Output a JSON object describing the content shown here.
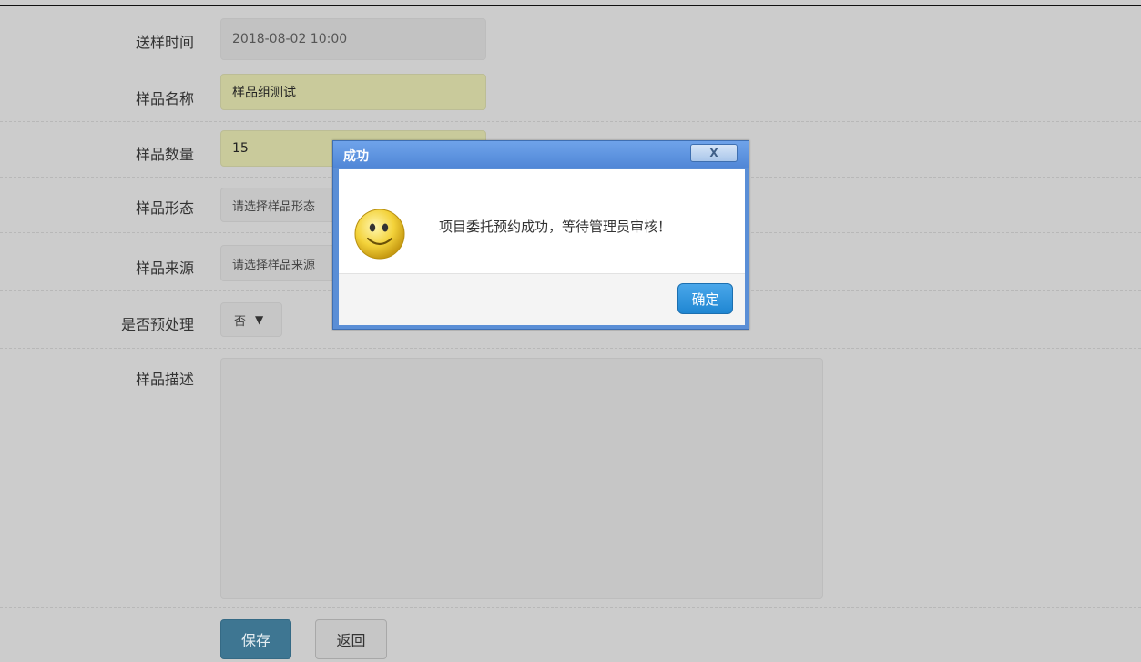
{
  "form": {
    "send_time": {
      "label": "送样时间",
      "value": "2018-08-02 10:00"
    },
    "sample_name": {
      "label": "样品名称",
      "value": "样品组测试"
    },
    "sample_count": {
      "label": "样品数量",
      "value": "15"
    },
    "sample_form": {
      "label": "样品形态",
      "value": "请选择样品形态"
    },
    "sample_source": {
      "label": "样品来源",
      "value": "请选择样品来源"
    },
    "pretreatment": {
      "label": "是否预处理",
      "value": "否",
      "caret": "▼"
    },
    "description": {
      "label": "样品描述",
      "value": ""
    },
    "buttons": {
      "save": "保存",
      "back": "返回"
    }
  },
  "dialog": {
    "title": "成功",
    "close": "X",
    "message": "项目委托预约成功，等待管理员审核！",
    "ok": "确定",
    "icon": "smiley-icon"
  }
}
